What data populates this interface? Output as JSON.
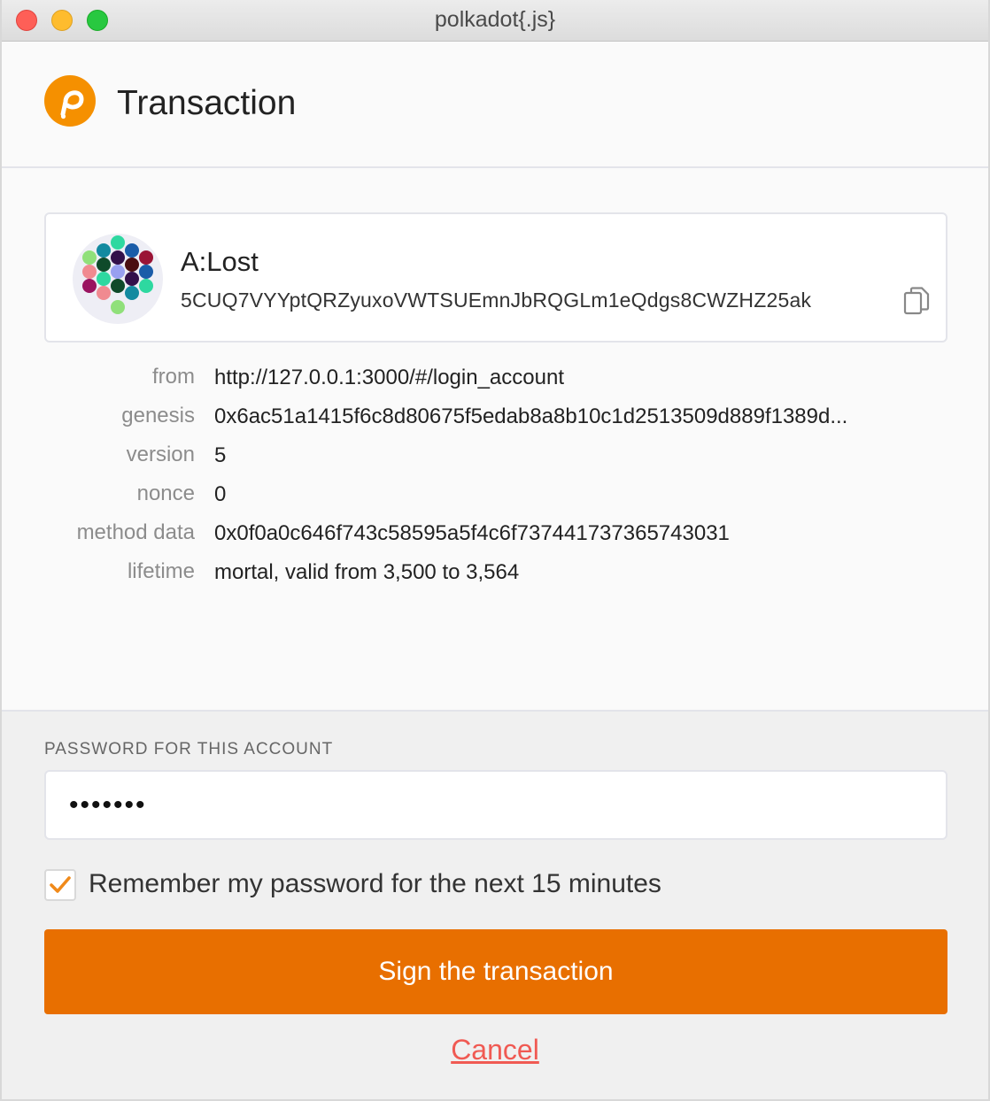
{
  "window": {
    "title": "polkadot{.js}"
  },
  "header": {
    "title": "Transaction",
    "logo_icon": "polkadot-logo-icon",
    "accent_color": "#f59000"
  },
  "account": {
    "name": "A:Lost",
    "address": "5CUQ7VYYptQRZyuxoVWTSUEmnJbRQGLm1eQdgs8CWZHZ25ak",
    "copy_icon": "copy-icon"
  },
  "details": [
    {
      "label": "from",
      "value": "http://127.0.0.1:3000/#/login_account"
    },
    {
      "label": "genesis",
      "value": "0x6ac51a1415f6c8d80675f5edab8a8b10c1d2513509d889f1389d..."
    },
    {
      "label": "version",
      "value": "5"
    },
    {
      "label": "nonce",
      "value": "0"
    },
    {
      "label": "method data",
      "value": "0x0f0a0c646f743c58595a5f4c6f737441737365743031"
    },
    {
      "label": "lifetime",
      "value": "mortal, valid from 3,500 to 3,564"
    }
  ],
  "password": {
    "label": "PASSWORD FOR THIS ACCOUNT",
    "value": "•••••••"
  },
  "remember": {
    "label": "Remember my password for the next 15 minutes",
    "checked": true
  },
  "actions": {
    "sign_label": "Sign the transaction",
    "cancel_label": "Cancel",
    "sign_color": "#e86f00",
    "cancel_color": "#f05a53"
  }
}
